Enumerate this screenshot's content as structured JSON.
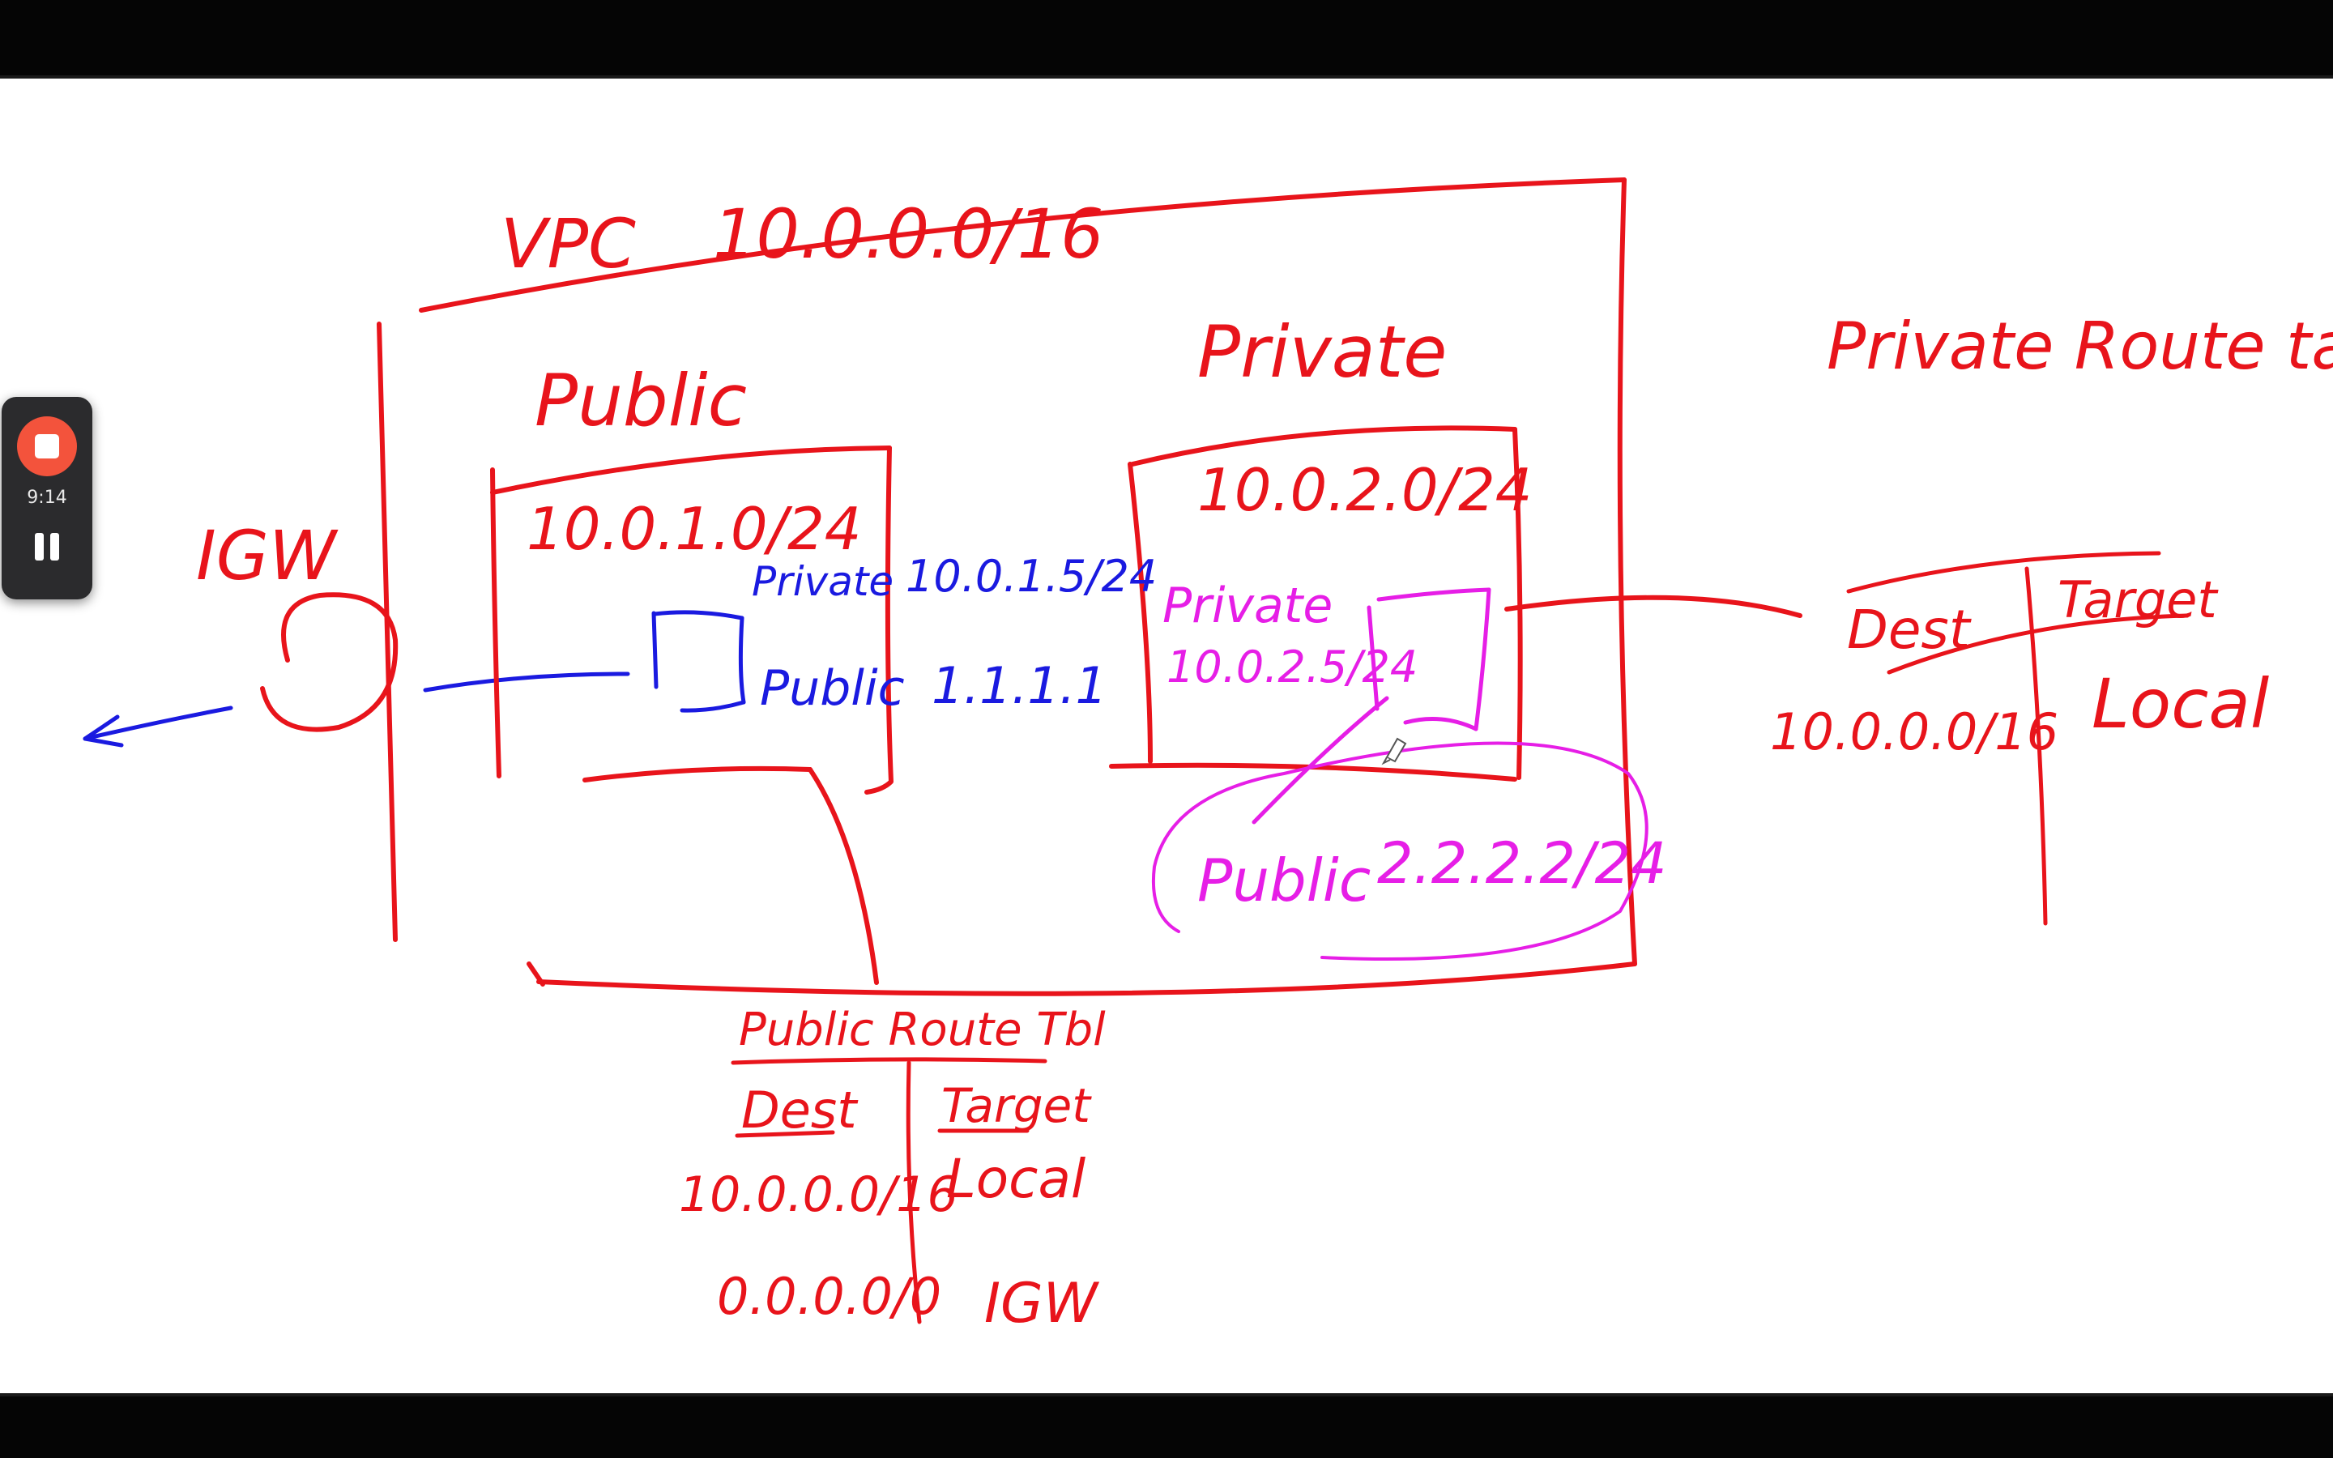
{
  "recorder": {
    "elapsed": "9:14",
    "stop_icon": "stop-icon",
    "pause_icon": "pause-icon"
  },
  "colors": {
    "red": "#e8141b",
    "blue": "#1a1ae0",
    "magenta": "#e61ee6",
    "canvas": "#ffffff",
    "recorder_stop": "#f3533c"
  },
  "diagram": {
    "vpc_label": "VPC",
    "vpc_cidr": "10.0.0.0/16",
    "igw_label": "IGW",
    "public_label": "Public",
    "public_subnet_cidr": "10.0.1.0/24",
    "public_instance": {
      "private_label": "Private",
      "private_ip": "10.0.1.5/24",
      "public_label": "Public",
      "public_ip": "1.1.1.1"
    },
    "private_label": "Private",
    "private_subnet_cidr": "10.0.2.0/24",
    "private_instance": {
      "private_label": "Private",
      "private_ip": "10.0.2.5/24",
      "public_label": "Public",
      "public_ip": "2.2.2.2/24"
    },
    "public_route_table": {
      "title": "Public Route Tbl",
      "dest_header": "Dest",
      "target_header": "Target",
      "rows": [
        {
          "dest": "10.0.0.0/16",
          "target": "Local"
        },
        {
          "dest": "0.0.0.0/0",
          "target": "IGW"
        }
      ]
    },
    "private_route_table": {
      "title": "Private Route table",
      "dest_header": "Dest",
      "target_header": "Target",
      "rows": [
        {
          "dest": "10.0.0.0/16",
          "target": "Local"
        }
      ]
    }
  }
}
